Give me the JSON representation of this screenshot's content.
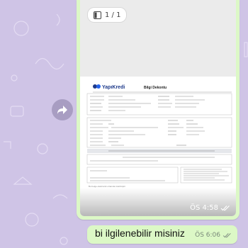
{
  "document_message": {
    "page_counter": "1 / 1",
    "time": "ÖS 4:58",
    "preview": {
      "bank_logo": "YapıKredi",
      "title": "Bilgi Dekontu",
      "footer_note": "Bu belge elektronik ortamda üretilmiştir"
    }
  },
  "text_message": {
    "text": "bi ilgilenebilir misiniz",
    "time": "ÖS 6:06"
  },
  "icons": {
    "forward": "forward-icon",
    "pages": "pages-icon",
    "read_receipt": "double-check-icon"
  },
  "colors": {
    "wallpaper": "#cfc4e6",
    "bubble": "#dcf8c6",
    "logo_blue": "#1e3a8a"
  }
}
